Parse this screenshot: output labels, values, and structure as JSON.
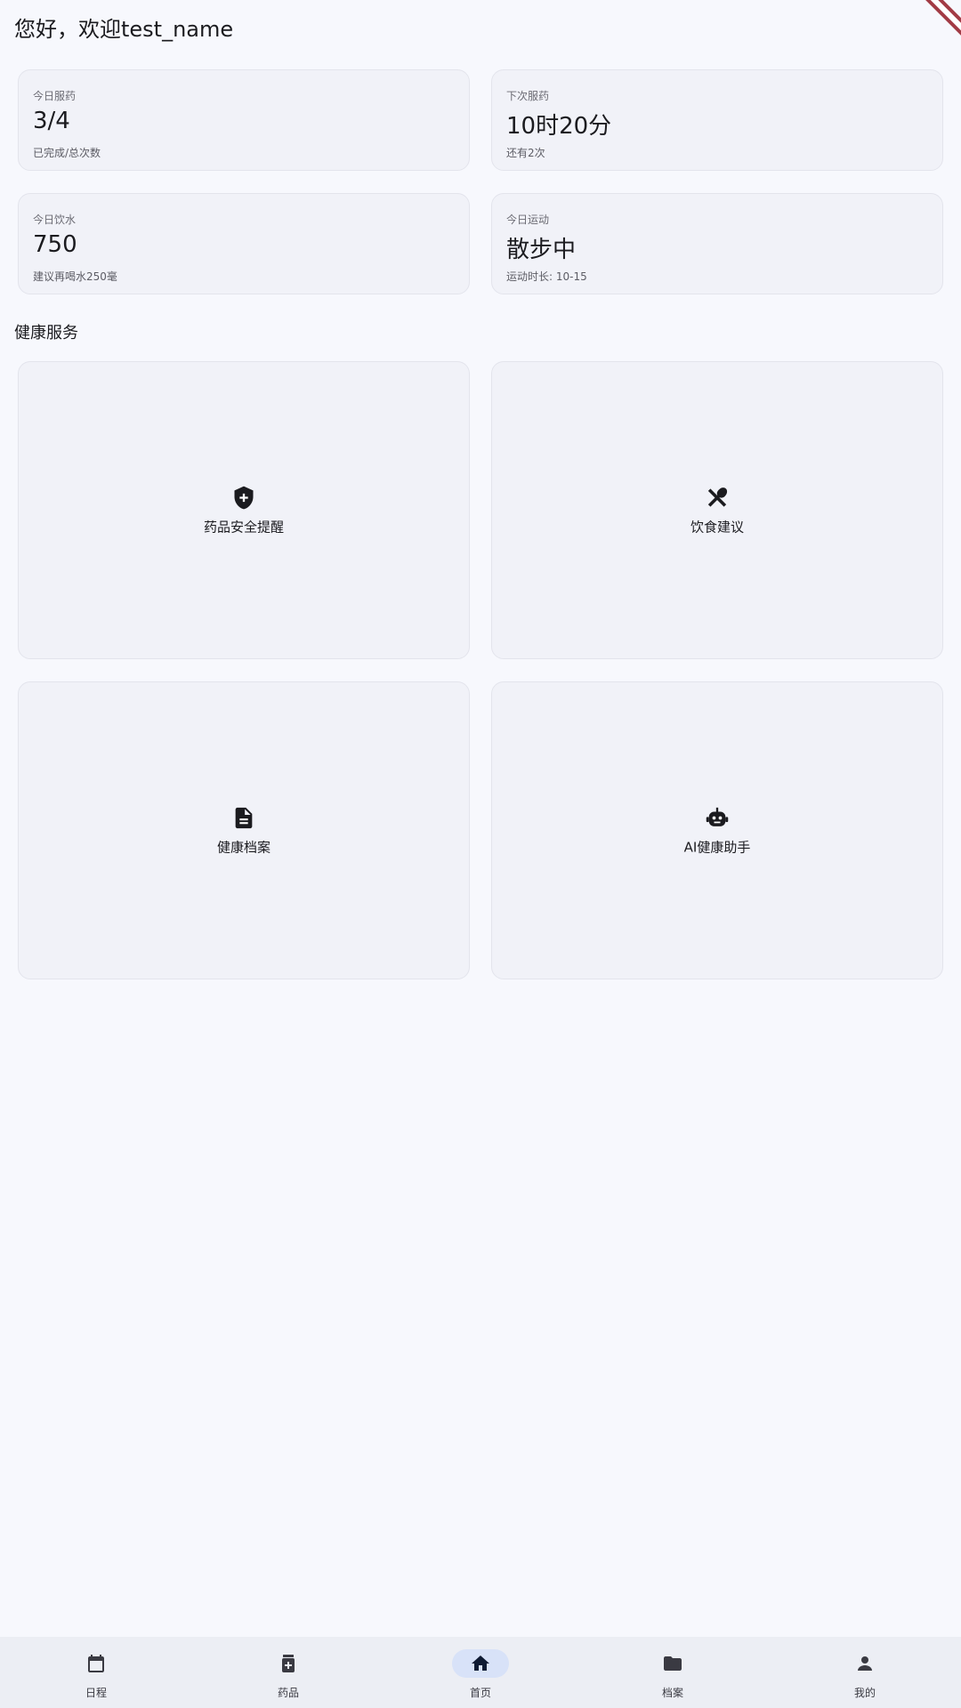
{
  "header": {
    "greeting": "您好，欢迎test_name"
  },
  "stats": [
    {
      "label": "今日服药",
      "value": "3/4",
      "sub": "已完成/总次数"
    },
    {
      "label": "下次服药",
      "value": "10时20分",
      "sub": "还有2次"
    },
    {
      "label": "今日饮水",
      "value": "750",
      "sub": "建议再喝水250毫"
    },
    {
      "label": "今日运动",
      "value": "散步中",
      "sub": "运动时长: 10-15"
    }
  ],
  "section": {
    "title": "健康服务"
  },
  "features": [
    {
      "icon": "shield-plus-icon",
      "label": "药品安全提醒"
    },
    {
      "icon": "utensils-icon",
      "label": "饮食建议"
    },
    {
      "icon": "document-icon",
      "label": "健康档案"
    },
    {
      "icon": "robot-icon",
      "label": "AI健康助手"
    }
  ],
  "nav": [
    {
      "icon": "calendar-icon",
      "label": "日程",
      "active": false
    },
    {
      "icon": "medicine-icon",
      "label": "药品",
      "active": false
    },
    {
      "icon": "home-icon",
      "label": "首页",
      "active": true
    },
    {
      "icon": "folder-icon",
      "label": "档案",
      "active": false
    },
    {
      "icon": "person-icon",
      "label": "我的",
      "active": false
    }
  ],
  "colors": {
    "background": "#f7f8fd",
    "card": "#f1f2f8",
    "nav_background": "#eceef4",
    "nav_active_pill": "#d8e2f8",
    "debug_ribbon": "#a23b45"
  }
}
